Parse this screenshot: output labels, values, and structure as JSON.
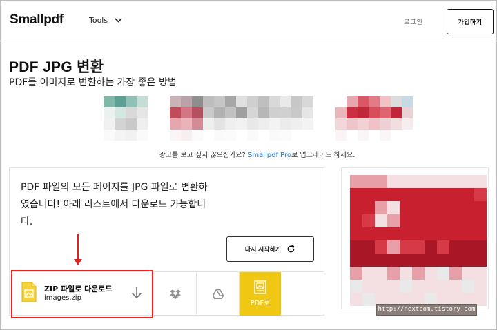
{
  "header": {
    "logo": "Smallpdf",
    "tools_label": "Tools",
    "login_label": "로그인",
    "signup_label": "가입하기"
  },
  "page": {
    "title": "PDF JPG 변환",
    "subtitle": "PDF를 이미지로 변환하는 가장 좋은 방법"
  },
  "ad_note": {
    "before": "광고를 보고 싶지 않으신가요? ",
    "link": "Smallpdf Pro",
    "after": "로 업그레이드 하세요."
  },
  "result": {
    "message": "PDF 파일의 모든 페이지를 JPG 파일로 변환하였습니다! 아래 리스트에서 다운로드 가능합니다.",
    "restart_label": "다시 시작하기",
    "download_title": "ZIP 파일로 다운로드",
    "download_filename": "images.zip",
    "to_pdf_label": "PDF로"
  },
  "icons": {
    "tools_chevron": "chevron-down-icon",
    "restart": "refresh-icon",
    "file": "image-file-icon",
    "download": "arrow-down-icon",
    "dropbox": "dropbox-icon",
    "drive": "google-drive-icon",
    "to_pdf": "image-to-pdf-icon"
  },
  "colors": {
    "accent_link": "#1a73c9",
    "to_pdf_bg": "#f0c814",
    "annotation": "#e22222",
    "ad_red": "#c8202e"
  },
  "watermark": "http://nextcom.tistory.com"
}
